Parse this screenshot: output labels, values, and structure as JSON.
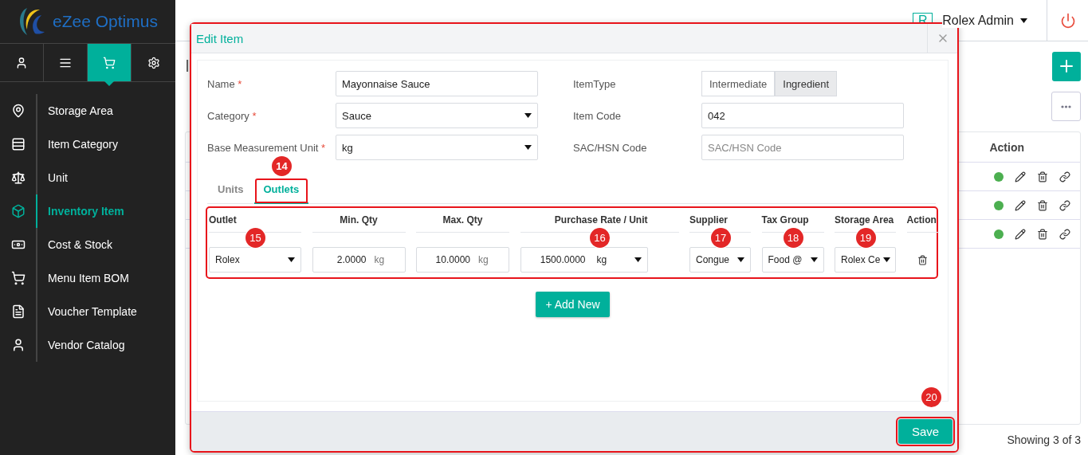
{
  "sidebar": {
    "logo": "eZee Optimus",
    "tabs": [
      {
        "kind": "user",
        "selected": false
      },
      {
        "kind": "menu",
        "selected": false
      },
      {
        "kind": "cart",
        "selected": true
      },
      {
        "kind": "settings",
        "selected": false
      }
    ],
    "items": [
      {
        "label": "Storage Area",
        "selected": false
      },
      {
        "label": "Item Category",
        "selected": false
      },
      {
        "label": "Unit",
        "selected": false
      },
      {
        "label": "Inventory Item",
        "selected": true
      },
      {
        "label": "Cost & Stock",
        "selected": false
      },
      {
        "label": "Menu Item BOM",
        "selected": false
      },
      {
        "label": "Voucher Template",
        "selected": false
      },
      {
        "label": "Vendor Catalog",
        "selected": false
      }
    ]
  },
  "header": {
    "avatar": "R",
    "user": "Rolex Admin"
  },
  "page": {
    "title": "I",
    "action_header": "Action",
    "rows": [
      {
        "active": true
      },
      {
        "active": true
      },
      {
        "active": true
      }
    ],
    "footer": "Showing 3 of 3"
  },
  "modal": {
    "title": "Edit Item",
    "highlighted": true,
    "fields": [
      {
        "label": "Name",
        "required_mark": "*",
        "kind": "text",
        "value": "Mayonnaise Sauce"
      },
      {
        "label": "ItemType",
        "kind": "toggle",
        "options": [
          {
            "label": "Intermediate",
            "selected": false
          },
          {
            "label": "Ingredient",
            "selected": true
          }
        ]
      },
      {
        "label": "Category",
        "required_mark": "*",
        "kind": "select",
        "value": "Sauce"
      },
      {
        "label": "Item Code",
        "kind": "text",
        "value": "042"
      },
      {
        "label": "Base Measurement Unit",
        "required_mark": "*",
        "kind": "select",
        "value": "kg"
      },
      {
        "label": "SAC/HSN Code",
        "kind": "text",
        "placeholder": "SAC/HSN Code"
      }
    ],
    "tabs": [
      {
        "label": "Units",
        "selected": false,
        "highlighted": false
      },
      {
        "label": "Outlets",
        "selected": true,
        "highlighted": true,
        "badge": "14"
      }
    ],
    "outlets": {
      "highlighted": true,
      "columns": [
        {
          "label": "Outlet",
          "badge": "15"
        },
        {
          "label": "Min. Qty"
        },
        {
          "label": "Max. Qty"
        },
        {
          "label": "Purchase Rate / Unit",
          "badge": "16"
        },
        {
          "label": "Supplier",
          "badge": "17"
        },
        {
          "label": "Tax Group",
          "badge": "18"
        },
        {
          "label": "Storage Area",
          "badge": "19"
        },
        {
          "label": "Action"
        }
      ],
      "rows": [
        {
          "cells": [
            {
              "kind": "select",
              "value": "Rolex"
            },
            {
              "kind": "qty",
              "value": "2.0000",
              "unit": "kg"
            },
            {
              "kind": "qty",
              "value": "10.0000",
              "unit": "kg"
            },
            {
              "kind": "rate",
              "value": "1500.0000",
              "unit": "kg"
            },
            {
              "kind": "select",
              "value": "Congue"
            },
            {
              "kind": "select",
              "value": "Food @"
            },
            {
              "kind": "select",
              "value": "Rolex Ce"
            },
            {
              "kind": "delete"
            }
          ]
        }
      ]
    },
    "add_button": "+ Add New",
    "save": {
      "label": "Save",
      "highlighted": true,
      "badge": "20"
    }
  }
}
